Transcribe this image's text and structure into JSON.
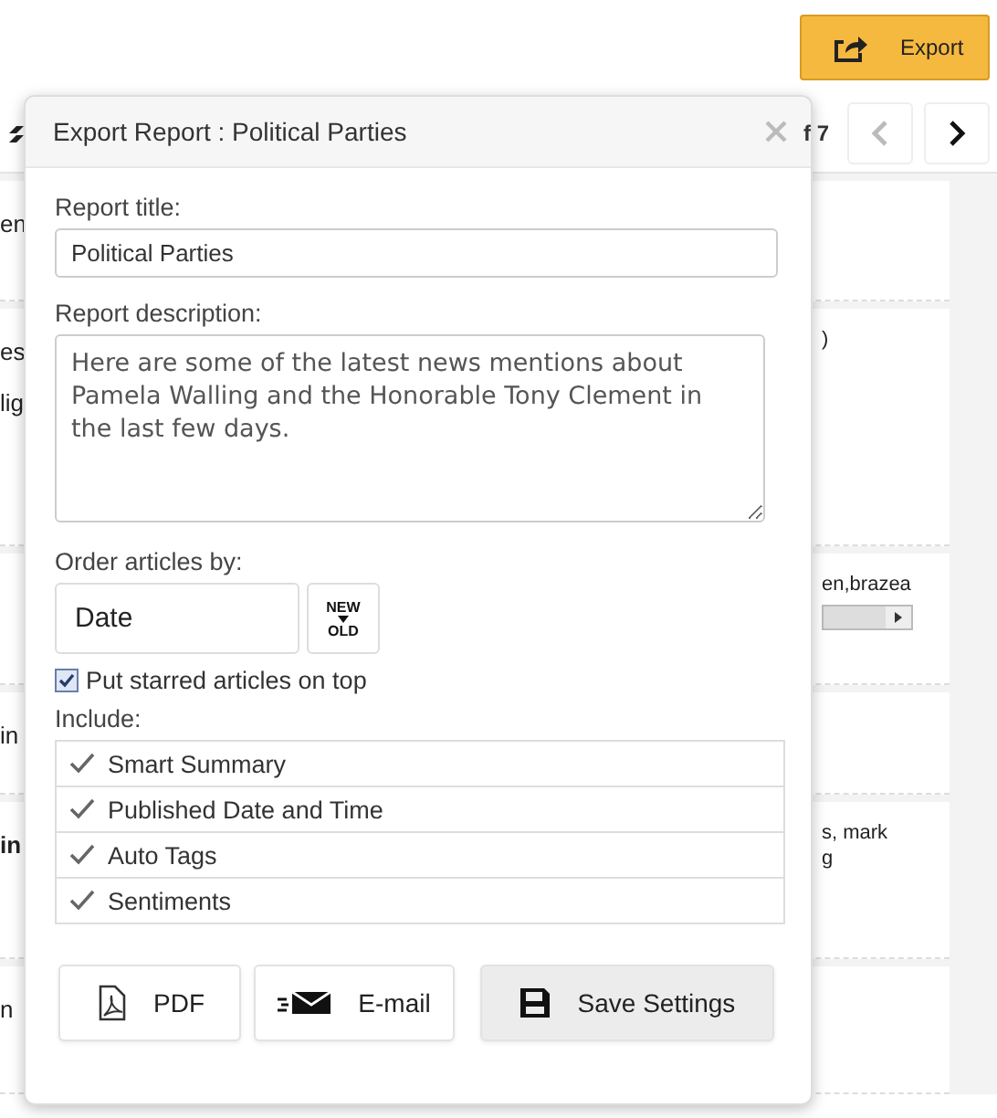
{
  "export_button": {
    "label": "Export"
  },
  "pager": {
    "text": "f 7",
    "buttons": [
      {
        "kind": "prev",
        "disabled": true
      },
      {
        "kind": "next",
        "disabled": false
      }
    ]
  },
  "background_rows": [
    {
      "left": [
        "en"
      ],
      "right": []
    },
    {
      "left": [
        "es",
        "lig"
      ],
      "right": [
        ")"
      ]
    },
    {
      "left": [],
      "right": [
        "en,brazea"
      ],
      "kind": "slider"
    },
    {
      "left": [
        "in"
      ],
      "right": []
    },
    {
      "left": [
        "in"
      ],
      "left_bold": true,
      "right": [
        "s, mark",
        "g"
      ]
    },
    {
      "left": [
        "n"
      ],
      "right": []
    }
  ],
  "dialog": {
    "title": "Export Report : Political Parties",
    "report_title": {
      "label": "Report title:",
      "value": "Political Parties"
    },
    "report_description": {
      "label": "Report description:",
      "value": "Here are some of the latest news mentions about Pamela Walling and the Honorable Tony Clement in the last few days."
    },
    "order": {
      "label": "Order articles by:",
      "value": "Date",
      "direction_top": "NEW",
      "direction_bottom": "OLD"
    },
    "starred": {
      "label": "Put starred articles on top",
      "checked": true
    },
    "include": {
      "label": "Include:",
      "items": [
        {
          "label": "Smart Summary",
          "checked": true
        },
        {
          "label": "Published Date and Time",
          "checked": true
        },
        {
          "label": "Auto Tags",
          "checked": true
        },
        {
          "label": "Sentiments",
          "checked": true
        }
      ]
    },
    "buttons": [
      {
        "kind": "pdf",
        "label": "PDF"
      },
      {
        "kind": "email",
        "label": "E-mail"
      },
      {
        "kind": "save",
        "label": "Save Settings"
      }
    ]
  }
}
